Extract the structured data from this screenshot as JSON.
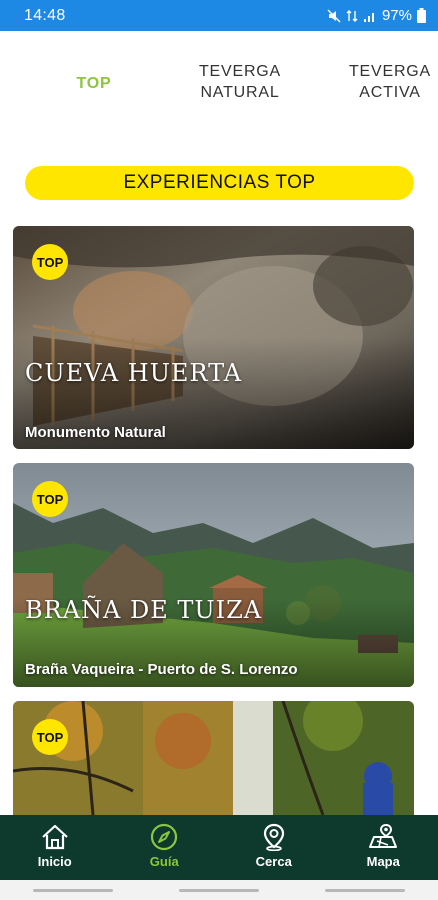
{
  "status_bar": {
    "time": "14:48",
    "battery": "97%"
  },
  "tabs": [
    {
      "label": "TOP"
    },
    {
      "label": "TEVERGA\nNATURAL"
    },
    {
      "label": "TEVERGA\nACTIVA"
    }
  ],
  "banner": {
    "label": "EXPERIENCIAS TOP"
  },
  "cards": [
    {
      "badge": "TOP",
      "title": "CUEVA HUERTA",
      "subtitle": "Monumento Natural"
    },
    {
      "badge": "TOP",
      "title": "BRAÑA DE TUIZA",
      "subtitle": "Braña Vaqueira - Puerto de S. Lorenzo"
    },
    {
      "badge": "TOP"
    }
  ],
  "bottom_nav": [
    {
      "label": "Inicio",
      "icon": "home-icon"
    },
    {
      "label": "Guía",
      "icon": "compass-icon"
    },
    {
      "label": "Cerca",
      "icon": "location-pin-icon"
    },
    {
      "label": "Mapa",
      "icon": "map-icon"
    }
  ],
  "colors": {
    "status_bar": "#1e88e5",
    "accent_green": "#8cc63f",
    "accent_yellow": "#ffe600",
    "nav_bg": "#0d3a2c"
  }
}
